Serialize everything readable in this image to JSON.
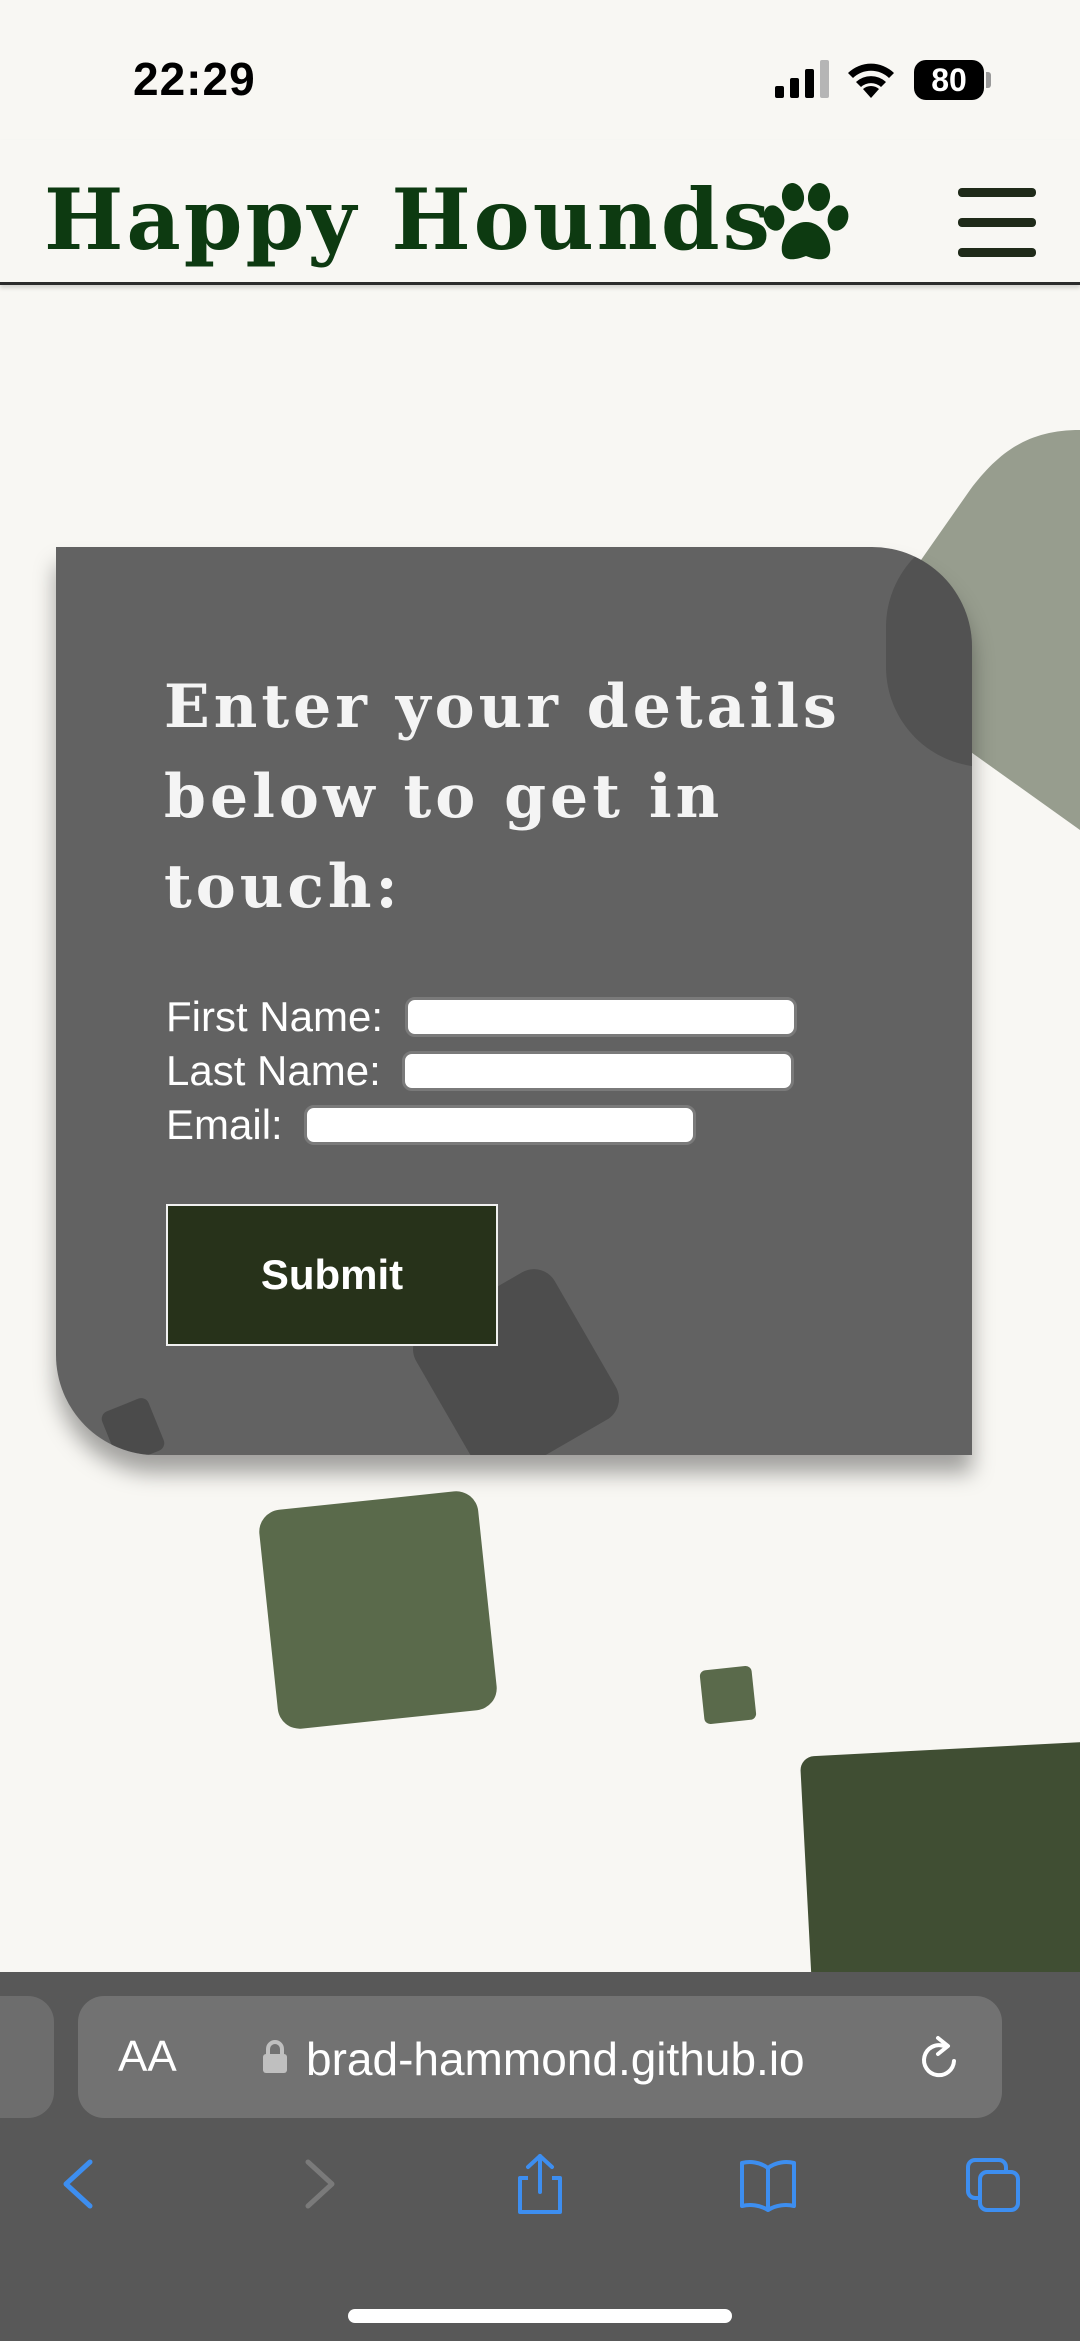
{
  "status_bar": {
    "time": "22:29",
    "battery": "80"
  },
  "header": {
    "brand": "Happy Hounds",
    "paw_icon": "paw-icon",
    "menu_icon": "hamburger-menu-icon",
    "brand_color": "#0d3a11"
  },
  "form": {
    "title": "Enter your details below to get in touch:",
    "first_name_label": "First Name:",
    "first_name_value": "",
    "last_name_label": "Last Name:",
    "last_name_value": "",
    "email_label": "Email:",
    "email_value": "",
    "submit_label": "Submit",
    "card_color": "#626262",
    "button_color": "#27321a"
  },
  "browser": {
    "text_size_label": "AA",
    "url": "brad-hammond.github.io",
    "accent": "#3d8ef0",
    "icons": [
      "back-icon",
      "forward-icon",
      "share-icon",
      "bookmarks-icon",
      "tabs-icon"
    ]
  }
}
